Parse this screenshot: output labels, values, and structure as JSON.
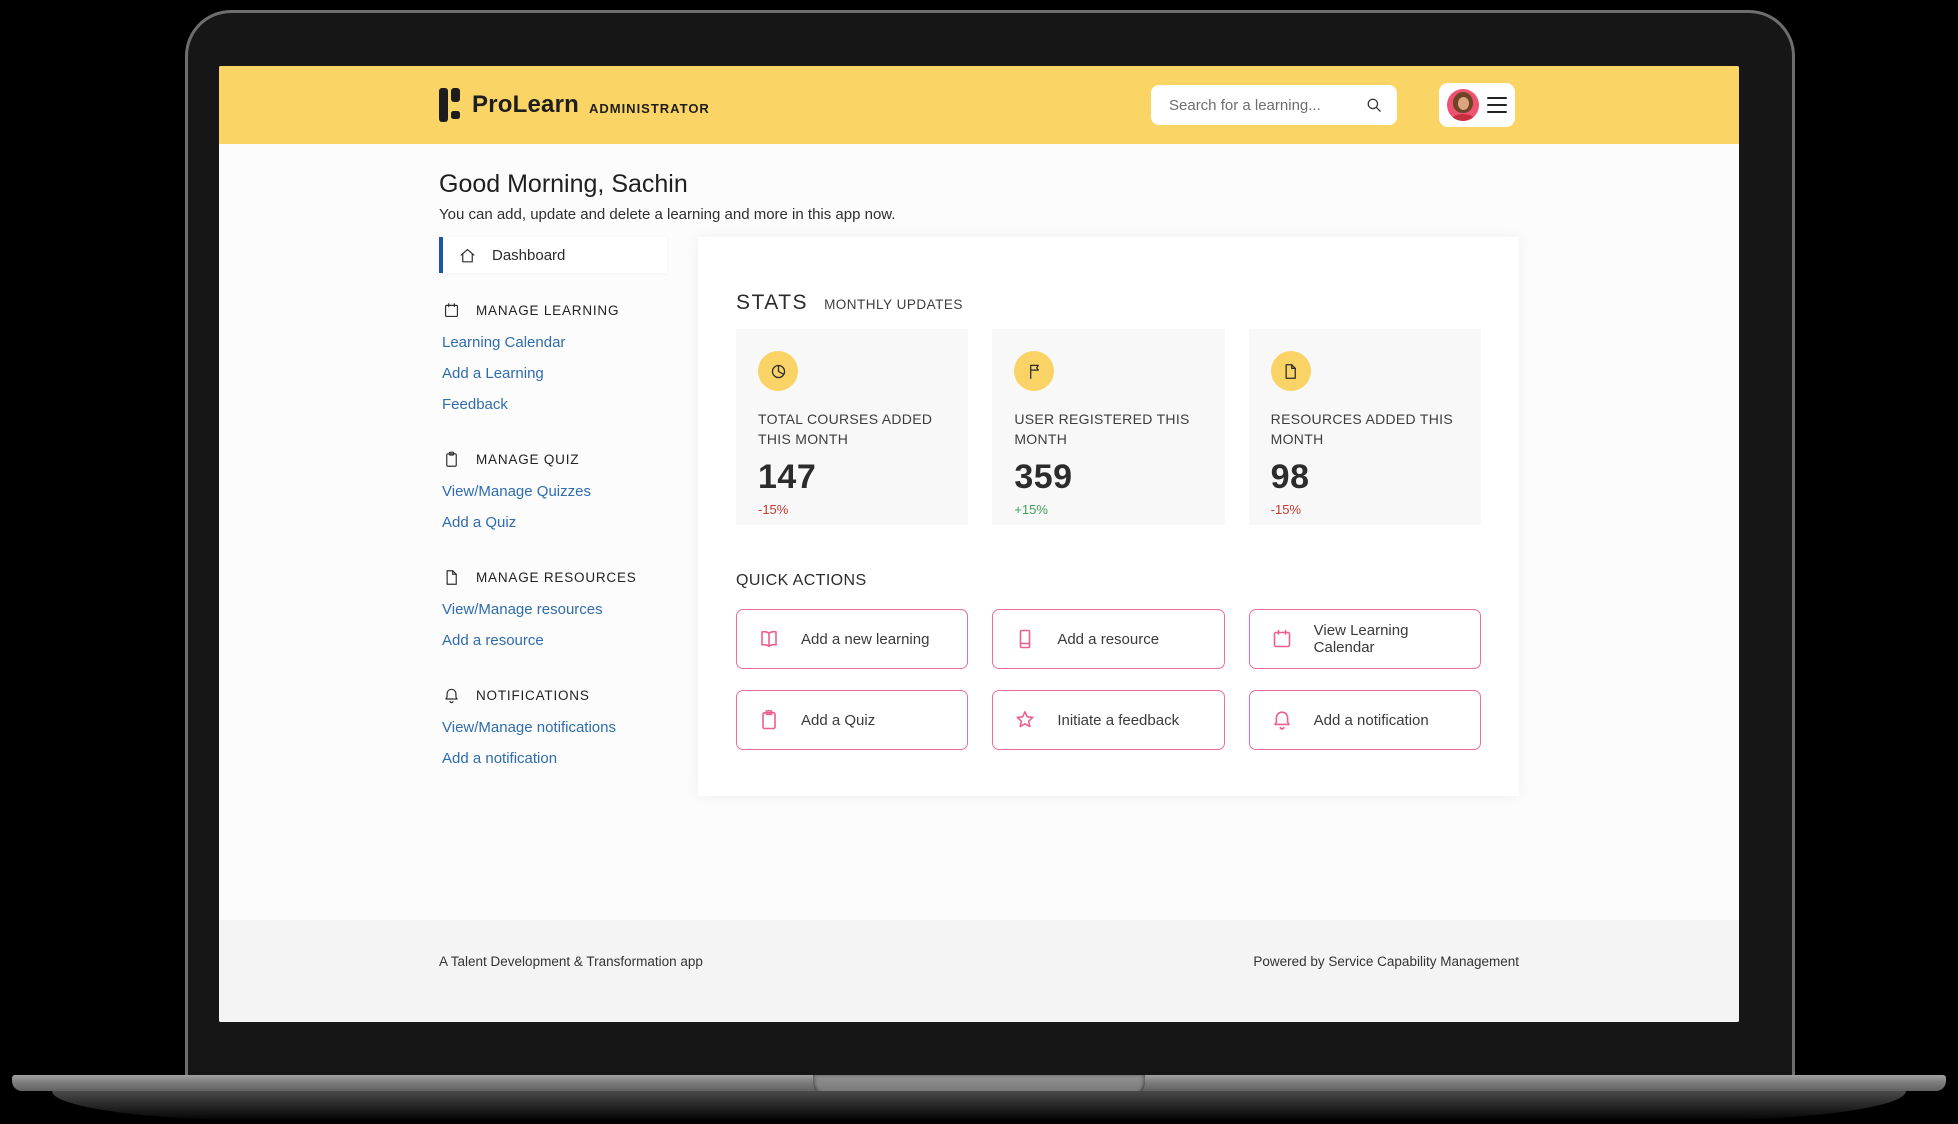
{
  "header": {
    "brand": "ProLearn",
    "brand_suffix": "ADMINISTRATOR",
    "search_placeholder": "Search for a learning..."
  },
  "greeting": {
    "title": "Good Morning, Sachin",
    "subtitle": "You can add, update and delete a learning and more in this app now."
  },
  "sidebar": {
    "dashboard": "Dashboard",
    "sections": [
      {
        "title": "MANAGE LEARNING",
        "icon": "calendar-icon",
        "links": [
          "Learning Calendar",
          "Add a Learning",
          "Feedback"
        ]
      },
      {
        "title": "MANAGE QUIZ",
        "icon": "clipboard-icon",
        "links": [
          "View/Manage Quizzes",
          "Add a Quiz"
        ]
      },
      {
        "title": "MANAGE RESOURCES",
        "icon": "document-icon",
        "links": [
          "View/Manage resources",
          "Add a resource"
        ]
      },
      {
        "title": "NOTIFICATIONS",
        "icon": "bell-icon",
        "links": [
          "View/Manage notifications",
          "Add a notification"
        ]
      }
    ]
  },
  "stats": {
    "title": "STATS",
    "subtitle": "MONTHLY UPDATES",
    "cards": [
      {
        "icon": "pie-chart-icon",
        "label": "TOTAL COURSES ADDED THIS MONTH",
        "value": "147",
        "delta": "-15%",
        "delta_style": "color:#c43a2f"
      },
      {
        "icon": "flag-icon",
        "label": "USER REGISTERED THIS MONTH",
        "value": "359",
        "delta": "+15%",
        "delta_style": "color:#43a05b"
      },
      {
        "icon": "document-icon",
        "label": "RESOURCES ADDED THIS MONTH",
        "value": "98",
        "delta": "-15%",
        "delta_style": "color:#c43a2f"
      }
    ]
  },
  "quick_actions": {
    "title": "QUICK ACTIONS",
    "buttons": [
      {
        "label": "Add a new learning",
        "icon": "book-open-icon"
      },
      {
        "label": "Add a resource",
        "icon": "book-icon"
      },
      {
        "label": "View Learning Calendar",
        "icon": "calendar-icon"
      },
      {
        "label": "Add a Quiz",
        "icon": "clipboard-icon"
      },
      {
        "label": "Initiate a feedback",
        "icon": "star-icon"
      },
      {
        "label": "Add a notification",
        "icon": "bell-icon"
      }
    ]
  },
  "footer": {
    "left": "A Talent Development & Transformation app",
    "right": "Powered by Service Capability Management"
  },
  "colors": {
    "header_yellow": "#fad464",
    "stat_circle_yellow": "#f9d366",
    "link_blue": "#2f6cae",
    "active_bar_blue": "#1c57a5",
    "action_border_pink": "#ee6d9c",
    "action_icon_pink": "#ec5f92",
    "delta_red": "#c43a2f",
    "delta_green": "#43a05b",
    "avatar_pink": "#ef5170"
  }
}
